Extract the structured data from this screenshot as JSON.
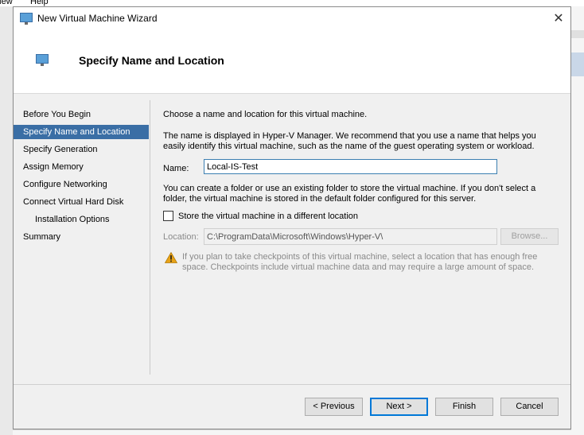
{
  "background": {
    "menu_items": [
      "View",
      "Help"
    ]
  },
  "window": {
    "title": "New Virtual Machine Wizard",
    "close_glyph": "✕"
  },
  "header": {
    "title": "Specify Name and Location"
  },
  "nav": {
    "items": [
      {
        "label": "Before You Begin",
        "active": false
      },
      {
        "label": "Specify Name and Location",
        "active": true
      },
      {
        "label": "Specify Generation",
        "active": false
      },
      {
        "label": "Assign Memory",
        "active": false
      },
      {
        "label": "Configure Networking",
        "active": false
      },
      {
        "label": "Connect Virtual Hard Disk",
        "active": false
      },
      {
        "label": "Installation Options",
        "active": false
      },
      {
        "label": "Summary",
        "active": false
      }
    ]
  },
  "content": {
    "intro": "Choose a name and location for this virtual machine.",
    "description": "The name is displayed in Hyper-V Manager. We recommend that you use a name that helps you easily identify this virtual machine, such as the name of the guest operating system or workload.",
    "name_label": "Name:",
    "name_value": "Local-IS-Test",
    "folder_text": "You can create a folder or use an existing folder to store the virtual machine. If you don't select a folder, the virtual machine is stored in the default folder configured for this server.",
    "checkbox_label": "Store the virtual machine in a different location",
    "checkbox_checked": false,
    "location_label": "Location:",
    "location_value": "C:\\ProgramData\\Microsoft\\Windows\\Hyper-V\\",
    "browse_label": "Browse...",
    "warning_text": "If you plan to take checkpoints of this virtual machine, select a location that has enough free space. Checkpoints include virtual machine data and may require a large amount of space."
  },
  "footer": {
    "previous_label": "< Previous",
    "next_label": "Next >",
    "finish_label": "Finish",
    "cancel_label": "Cancel"
  },
  "colors": {
    "nav_active": "#3a6ea5",
    "primary_border": "#0078d7",
    "warning_icon": "#e8a317"
  }
}
